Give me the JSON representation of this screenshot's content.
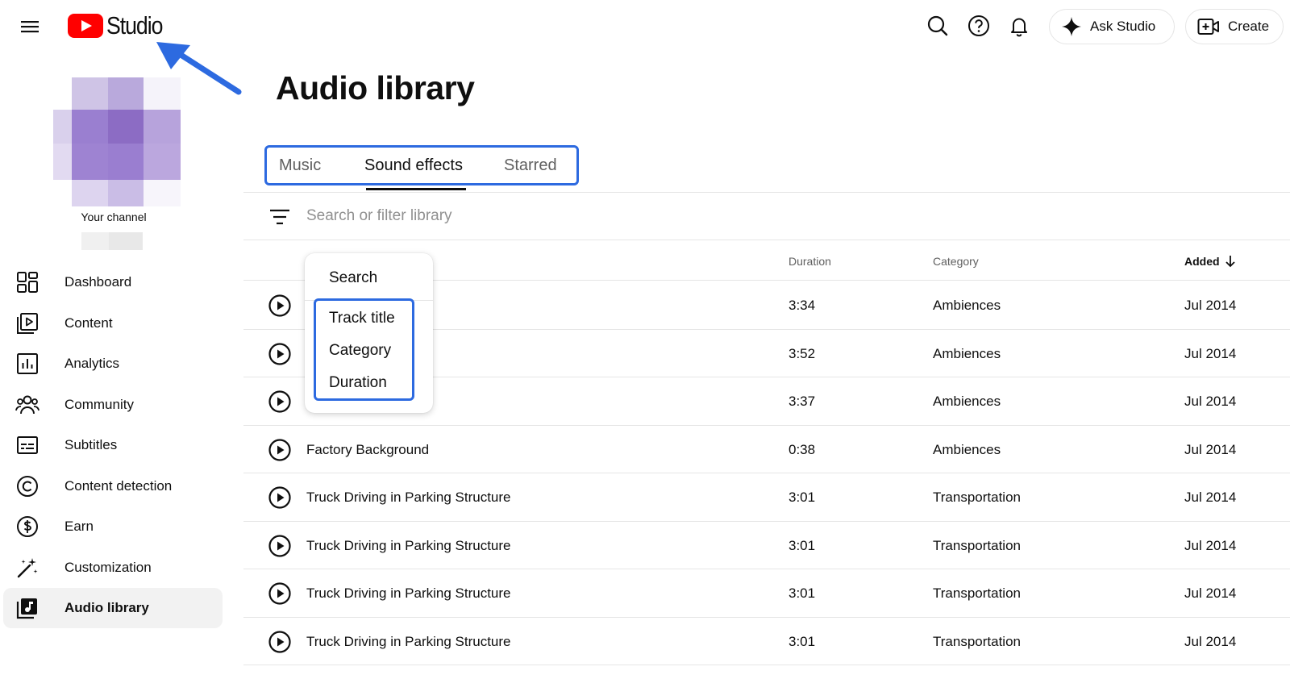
{
  "header": {
    "logo_text": "Studio",
    "ask_studio_label": "Ask Studio",
    "create_label": "Create"
  },
  "sidebar": {
    "channel_label": "Your channel",
    "items": [
      {
        "label": "Dashboard",
        "icon": "dashboard-icon"
      },
      {
        "label": "Content",
        "icon": "content-icon"
      },
      {
        "label": "Analytics",
        "icon": "analytics-icon"
      },
      {
        "label": "Community",
        "icon": "community-icon"
      },
      {
        "label": "Subtitles",
        "icon": "subtitles-icon"
      },
      {
        "label": "Content detection",
        "icon": "copyright-icon"
      },
      {
        "label": "Earn",
        "icon": "dollar-icon"
      },
      {
        "label": "Customization",
        "icon": "magic-wand-icon"
      },
      {
        "label": "Audio library",
        "icon": "audio-library-icon",
        "active": true
      }
    ]
  },
  "main": {
    "title": "Audio library",
    "tabs": [
      {
        "label": "Music"
      },
      {
        "label": "Sound effects",
        "active": true
      },
      {
        "label": "Starred"
      }
    ],
    "search": {
      "placeholder": "Search or filter library"
    },
    "columns": {
      "duration": "Duration",
      "category": "Category",
      "added": "Added"
    },
    "rows": [
      {
        "title": "",
        "duration": "3:34",
        "category": "Ambiences",
        "added": "Jul 2014"
      },
      {
        "title": "",
        "duration": "3:52",
        "category": "Ambiences",
        "added": "Jul 2014"
      },
      {
        "title": "",
        "duration": "3:37",
        "category": "Ambiences",
        "added": "Jul 2014"
      },
      {
        "title": "Factory Background",
        "duration": "0:38",
        "category": "Ambiences",
        "added": "Jul 2014"
      },
      {
        "title": "Truck Driving in Parking Structure",
        "duration": "3:01",
        "category": "Transportation",
        "added": "Jul 2014"
      },
      {
        "title": "Truck Driving in Parking Structure",
        "duration": "3:01",
        "category": "Transportation",
        "added": "Jul 2014"
      },
      {
        "title": "Truck Driving in Parking Structure",
        "duration": "3:01",
        "category": "Transportation",
        "added": "Jul 2014"
      },
      {
        "title": "Truck Driving in Parking Structure",
        "duration": "3:01",
        "category": "Transportation",
        "added": "Jul 2014"
      }
    ]
  },
  "menu": {
    "items": [
      "Search",
      "Track title",
      "Category",
      "Duration"
    ]
  },
  "colors": {
    "brand_red": "#ff0000",
    "highlight_blue": "#2d6ae0",
    "avatar_purple": "#8c6cc4"
  }
}
